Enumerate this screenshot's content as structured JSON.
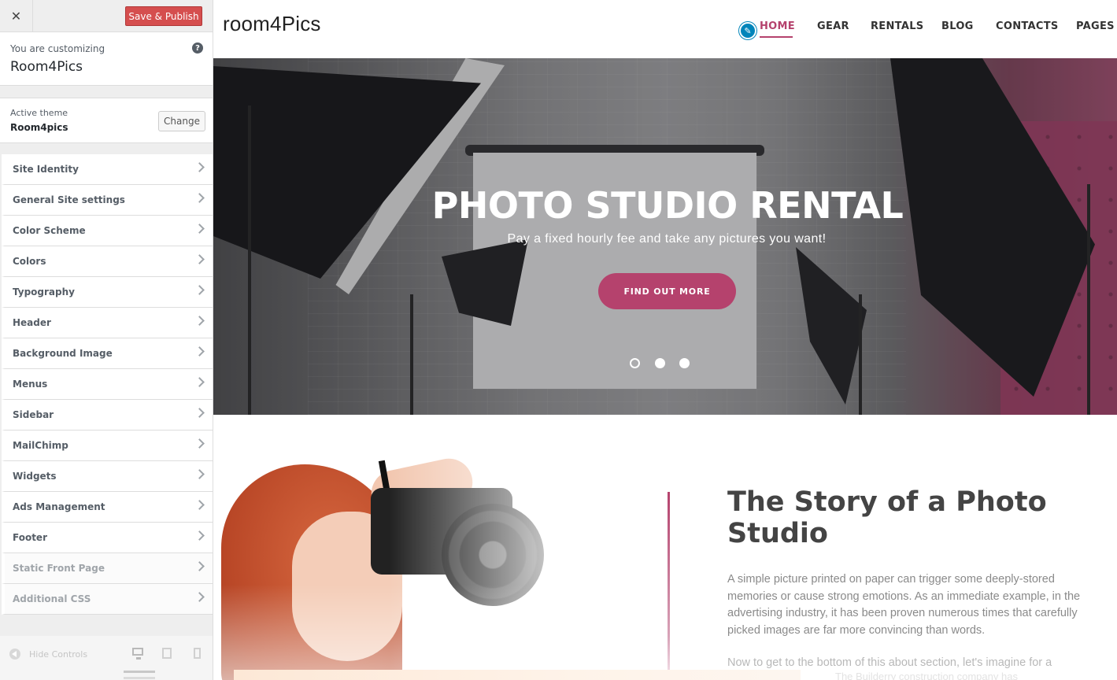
{
  "customizer": {
    "close_icon": "close-icon",
    "save_label": "Save & Publish",
    "info_sub": "You are customizing",
    "info_name": "Room4Pics",
    "help_glyph": "?",
    "active_theme_label": "Active theme",
    "active_theme_value": "Room4pics",
    "change_label": "Change",
    "sections": [
      {
        "label": "Site Identity"
      },
      {
        "label": "General Site settings"
      },
      {
        "label": "Color Scheme"
      },
      {
        "label": "Colors"
      },
      {
        "label": "Typography"
      },
      {
        "label": "Header"
      },
      {
        "label": "Background Image"
      },
      {
        "label": "Menus"
      },
      {
        "label": "Sidebar"
      },
      {
        "label": "MailChimp"
      },
      {
        "label": "Widgets"
      },
      {
        "label": "Ads Management"
      },
      {
        "label": "Footer"
      },
      {
        "label": "Static Front Page"
      },
      {
        "label": "Additional CSS"
      }
    ],
    "hide_controls_label": "Hide Controls",
    "accent_color": "#d54e4e"
  },
  "site": {
    "logo": "room4Pics",
    "nav": [
      "HOME",
      "GEAR",
      "RENTALS",
      "BLOG",
      "CONTACTS",
      "PAGES"
    ],
    "active_nav": "HOME",
    "brand_color": "#b5426d",
    "hero": {
      "title": "PHOTO STUDIO RENTAL",
      "subtitle": "Pay a fixed hourly fee and take any pictures you want!",
      "button": "FIND OUT MORE",
      "slides": 3,
      "active_slide": 1
    },
    "about": {
      "title": "The Story of a Photo Studio",
      "p1": "A simple picture printed on paper can trigger some deeply-stored memories or cause strong emotions. As an immediate example, in the advertising industry, it has been proven numerous times that carefully picked images are far more convincing than words.",
      "p2": "Now to get to the bottom of this about section, let's imagine for a",
      "p3": "The Builderry construction company has"
    }
  }
}
